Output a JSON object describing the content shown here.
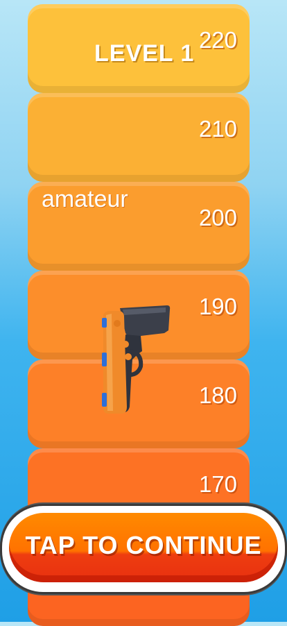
{
  "level": {
    "label": "LEVEL 1"
  },
  "rank": {
    "label": "amateur"
  },
  "tower": {
    "blocks": [
      {
        "value": "220",
        "color": "#fdc13b"
      },
      {
        "value": "210",
        "color": "#fbb034"
      },
      {
        "value": "200",
        "color": "#fb9d2e"
      },
      {
        "value": "190",
        "color": "#fc8e2b"
      },
      {
        "value": "180",
        "color": "#fd8028"
      },
      {
        "value": "170",
        "color": "#fd7224"
      },
      {
        "value": "",
        "color": "#fc6421"
      }
    ]
  },
  "weapon": {
    "icon": "pistol-icon"
  },
  "continue_button": {
    "label": "TAP TO CONTINUE"
  },
  "colors": {
    "button_top": "#ff8a00",
    "button_bottom": "#e83010",
    "sky_top": "#b8e6f7",
    "sky_bottom": "#1f9fe6"
  }
}
